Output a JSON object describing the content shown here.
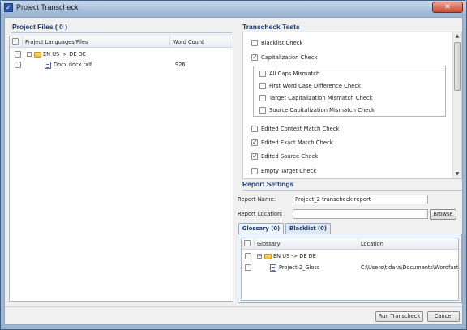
{
  "window": {
    "title": "Project Transcheck",
    "close_glyph": "✕"
  },
  "project_files": {
    "heading": "Project Files ( 0 )",
    "columns": [
      "Project Languages/Files",
      "Word Count"
    ],
    "rows": [
      {
        "label": "EN US -> DE DE",
        "word_count": ""
      },
      {
        "label": "Docx.docx.txlf",
        "word_count": "926"
      }
    ]
  },
  "transcheck_tests": {
    "heading": "Transcheck Tests",
    "items_top": [
      {
        "label": "Blacklist Check",
        "checked": false
      },
      {
        "label": "Capitalization Check",
        "checked": true
      }
    ],
    "cap_sub_items": [
      {
        "label": "All Caps Mismatch",
        "checked": false
      },
      {
        "label": "First Word Case Difference Check",
        "checked": false
      },
      {
        "label": "Target Capitalization Mismatch Check",
        "checked": false
      },
      {
        "label": "Source Capitalization Mismatch Check",
        "checked": false
      }
    ],
    "items_bottom": [
      {
        "label": "Edited Context Match Check",
        "checked": false
      },
      {
        "label": "Edited Exact Match Check",
        "checked": true
      },
      {
        "label": "Edited Source Check",
        "checked": true
      },
      {
        "label": "Empty Target Check",
        "checked": false
      }
    ],
    "scroll_up": "▲",
    "scroll_down": "▼"
  },
  "report_settings": {
    "heading": "Report Settings",
    "name_label": "Report Name:",
    "name_value": "Project_2 transcheck report",
    "location_label": "Report Location:",
    "location_value": "",
    "browse_label": "Browse"
  },
  "tabs": {
    "glossary": "Glossary (0)",
    "blacklist": "Blacklist (0)"
  },
  "glossary_grid": {
    "columns": [
      "Glossary",
      "Location"
    ],
    "rows": [
      {
        "label": "EN US -> DE DE",
        "location": ""
      },
      {
        "label": "Project-2_Gloss",
        "location": "C:\\Users\\tldara\\Documents\\Wordfast..."
      }
    ]
  },
  "footer": {
    "run_label": "Run Transcheck",
    "cancel_label": "Cancel"
  }
}
